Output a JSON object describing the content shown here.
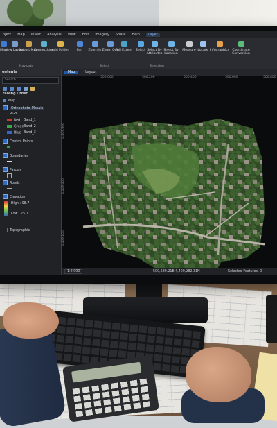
{
  "ribbon": {
    "menu": [
      "oject",
      "Map",
      "Insert",
      "Analysis",
      "View",
      "Edit",
      "Imagery",
      "Share",
      "Help",
      "Layer"
    ],
    "active_menu": "Layer",
    "buttons": [
      {
        "label": "Map",
        "icon": "map-icon"
      },
      {
        "label": "New Layout",
        "icon": "layout-icon"
      },
      {
        "label": "Import Map",
        "icon": "import-icon"
      },
      {
        "label": "Connections",
        "icon": "connections-icon"
      },
      {
        "label": "Add Folder",
        "icon": "folder-icon"
      },
      {
        "label": "Pan",
        "icon": "pan-icon"
      },
      {
        "label": "Zoom In",
        "icon": "zoom-in-icon"
      },
      {
        "label": "Zoom Out",
        "icon": "zoom-out-icon"
      },
      {
        "label": "Full Extent",
        "icon": "full-extent-icon"
      },
      {
        "label": "Select",
        "icon": "select-icon"
      },
      {
        "label": "Select By Attributes",
        "icon": "select-attributes-icon"
      },
      {
        "label": "Select By Location",
        "icon": "select-location-icon"
      },
      {
        "label": "Measure",
        "icon": "measure-icon"
      },
      {
        "label": "Locate",
        "icon": "locate-icon"
      },
      {
        "label": "Infographics",
        "icon": "infographics-icon"
      },
      {
        "label": "Coordinate Conversion",
        "icon": "coordinate-icon"
      }
    ],
    "groups": [
      "Navigate",
      "Select",
      "Selection"
    ]
  },
  "contents": {
    "title": "ontents",
    "search_placeholder": "Search",
    "drawing_order": "rawing Order",
    "items": {
      "map": "Map",
      "ortho": "Orthophoto_Mosaic",
      "rgb": "RGB",
      "red": "Red",
      "band1": "Band_1",
      "green": "Green",
      "band2": "Band_2",
      "blue": "Blue",
      "band3": "Band_3",
      "control": "Control Points",
      "boundaries": "Boundaries",
      "parcels": "Parcels",
      "roads": "Roads",
      "elevation": "Elevation",
      "high": "High : 98.7",
      "low": "Low : 75.1",
      "topographic": "Topographic"
    },
    "colors": {
      "red": "#d03a2e",
      "green": "#3aa64a",
      "blue": "#3b64c8"
    }
  },
  "map_view": {
    "tab_map": "Map",
    "tab_layout": "Layout",
    "ruler_top": [
      "500,000",
      "500,200",
      "500,400",
      "500,600",
      "500,800"
    ],
    "ruler_left": [
      "4,409,600",
      "4,409,400",
      "4,409,200"
    ],
    "scale": "1:2,000",
    "coordinates": "500,689.21E  4,409,282.31N",
    "selected_features": "Selected Features: 0"
  }
}
